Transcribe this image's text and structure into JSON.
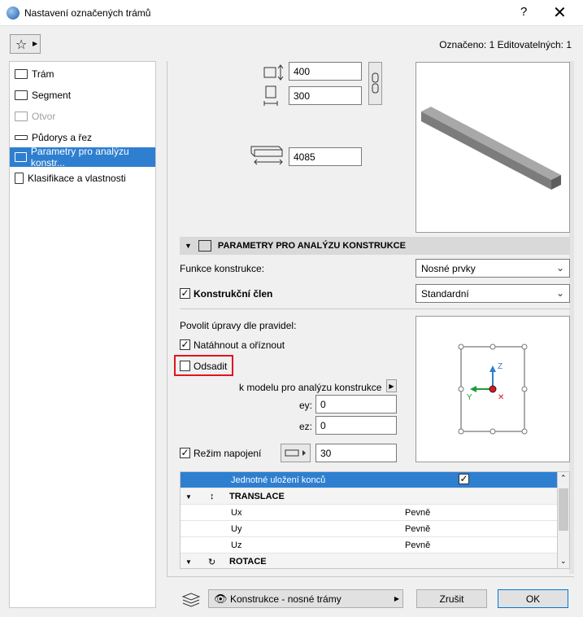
{
  "window": {
    "title": "Nastavení označených trámů",
    "help": "?",
    "close": "✕"
  },
  "selection_info": "Označeno: 1 Editovatelných: 1",
  "nav": [
    {
      "label": "Trám"
    },
    {
      "label": "Segment"
    },
    {
      "label": "Otvor"
    },
    {
      "label": "Půdorys a řez"
    },
    {
      "label": "Parametry pro analýzu konstr..."
    },
    {
      "label": "Klasifikace a vlastnosti"
    }
  ],
  "geometry": {
    "height": "400",
    "width": "300",
    "length": "4085"
  },
  "section": {
    "title": "PARAMETRY PRO ANALÝZU KONSTRUKCE"
  },
  "function": {
    "label": "Funkce konstrukce:",
    "value": "Nosné prvky"
  },
  "member": {
    "label": "Konstrukční člen",
    "value": "Standardní",
    "checked": "✓"
  },
  "rules": {
    "label": "Povolit úpravy dle pravidel:",
    "extend_trim": "Natáhnout a oříznout",
    "extend_checked": "✓",
    "offset": "Odsadit",
    "model_label": "k modelu pro analýzu konstrukce",
    "ey_label": "ey:",
    "ey": "0",
    "ez_label": "ez:",
    "ez": "0"
  },
  "junction": {
    "label": "Režim napojení",
    "value": "30",
    "checked": "✓"
  },
  "axes": {
    "z": "Z",
    "y": "Y",
    "x": "✕"
  },
  "table": {
    "rows": [
      {
        "type": "selected",
        "col1": "Jednotné uložení konců",
        "col2": "✓"
      },
      {
        "type": "grp",
        "col1": "TRANSLACE",
        "icon": "↕"
      },
      {
        "type": "item",
        "col1": "Ux",
        "col2": "Pevně"
      },
      {
        "type": "item",
        "col1": "Uy",
        "col2": "Pevně"
      },
      {
        "type": "item",
        "col1": "Uz",
        "col2": "Pevně"
      },
      {
        "type": "grp",
        "col1": "ROTACE",
        "icon": "↻"
      }
    ]
  },
  "footer": {
    "layer": "Konstrukce - nosné trámy",
    "cancel": "Zrušit",
    "ok": "OK"
  },
  "colors": {
    "accent": "#2e7fd0",
    "highlight": "#e0141e"
  }
}
